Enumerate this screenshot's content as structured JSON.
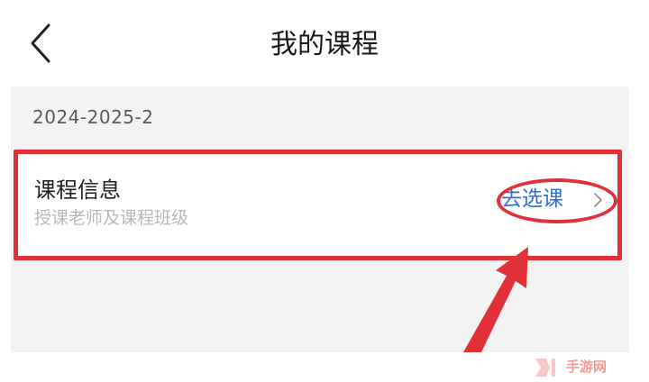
{
  "header": {
    "title": "我的课程",
    "back_icon": "chevron-left-icon"
  },
  "term": {
    "label": "2024-2025-2"
  },
  "course_card": {
    "title": "课程信息",
    "subtitle": "授课老师及课程班级",
    "action_label": "去选课",
    "action_icon": "chevron-right-icon"
  },
  "annotation": {
    "color": "#e23038"
  },
  "watermark": {
    "text": "手游网"
  }
}
